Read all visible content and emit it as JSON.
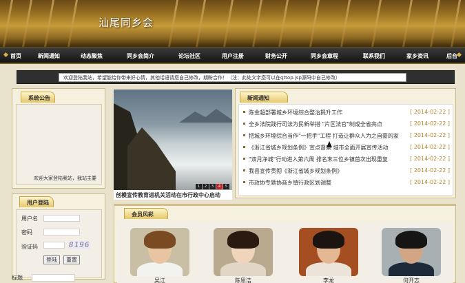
{
  "header": {
    "site_title": "汕尾同乡会"
  },
  "nav": {
    "items": [
      "首页",
      "新闻通知",
      "动态聚焦",
      "同乡会简介",
      "论坛社区",
      "用户注册",
      "财务公开",
      "同乡会章程",
      "联系我们",
      "家乡资讯",
      "后台"
    ]
  },
  "marquee": {
    "text": "欢迎登陆我站，希望能给你带来好心情，其他话语请您自己修改，期盼合作！（注：此处文字您可以在qttop.jsp源码中自己修改）"
  },
  "notice_panel": {
    "title": "系统公告",
    "text": "欢迎大家登陆我站，我站主要"
  },
  "login": {
    "title": "用户登陆",
    "username_label": "用户名",
    "password_label": "密码",
    "captcha_label": "验证码",
    "captcha_value": "8196",
    "login_button": "登陆",
    "reset_button": "重置",
    "extra_label": "标题"
  },
  "slider": {
    "caption": "创模宣传教育进机关活动在市行政中心启动",
    "dots": [
      "1",
      "2",
      "3",
      "4",
      "5"
    ],
    "active_dot": 4
  },
  "news": {
    "title": "新闻通知",
    "items": [
      {
        "title": "陈金超部署城乡环境综合整治提升工作",
        "date": "[ 2014-02-22 ]"
      },
      {
        "title": "全乡法院践行司法为民新举措 \"片区法官\"制成全省亮点",
        "date": "[ 2014-02-22 ]"
      },
      {
        "title": "把城乡环境综合当作\"一把手\"工程 打造让群众人为之自豪的家",
        "date": "[ 2014-02-22 ]"
      },
      {
        "title": "《浙江省城乡规划条例》宣点督察 城市全面开展宣传活动",
        "date": "[ 2014-02-22 ]"
      },
      {
        "title": "\"双月净城\"行动进入第六周 排名末三位乡镇首次出现重复",
        "date": "[ 2014-02-22 ]"
      },
      {
        "title": "我县宣传贯彻《浙江省城乡规划条例》",
        "date": "[ 2014-02-22 ]"
      },
      {
        "title": "市政协专题协商乡镇行政区划调整",
        "date": "[ 2014-02-22 ]"
      }
    ]
  },
  "members": {
    "title": "会员风彩",
    "people": [
      {
        "name": "吴江"
      },
      {
        "name": "陈思洁"
      },
      {
        "name": "李龙"
      },
      {
        "name": "何开志"
      }
    ]
  }
}
